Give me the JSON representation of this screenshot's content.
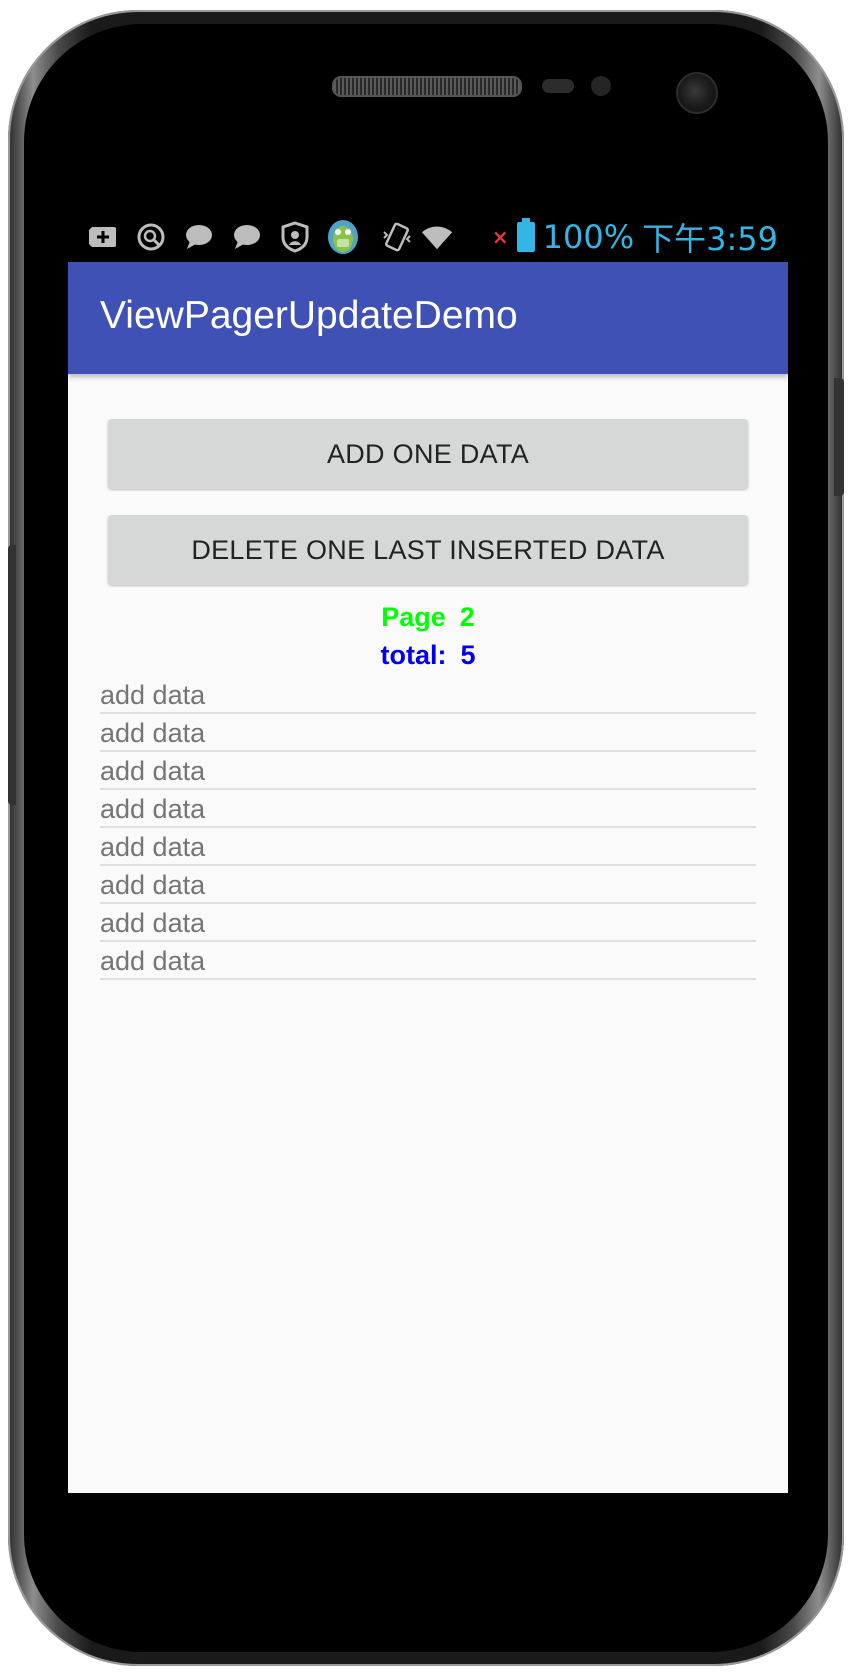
{
  "status_bar": {
    "icons": [
      "add-box-icon",
      "search-circle-icon",
      "chat-bubble-icon",
      "chat-bubble-icon",
      "shield-icon",
      "app-mascot-icon",
      "vibrate-icon",
      "wifi-icon",
      "no-signal-x-icon",
      "battery-icon"
    ],
    "battery": "100%",
    "time": "下午3:59",
    "accent_color": "#33b5e5"
  },
  "app_bar": {
    "title": "ViewPagerUpdateDemo",
    "color": "#3f51b5"
  },
  "buttons": {
    "add_label": "ADD ONE DATA",
    "delete_label": "DELETE ONE LAST INSERTED DATA"
  },
  "pager": {
    "page_label": "Page",
    "page_value": "2",
    "page_color": "#00ff00",
    "total_label": "total:",
    "total_value": "5",
    "total_color": "#0000ee"
  },
  "list": {
    "items": [
      "add data",
      "add data",
      "add data",
      "add data",
      "add data",
      "add data",
      "add data",
      "add data"
    ]
  }
}
